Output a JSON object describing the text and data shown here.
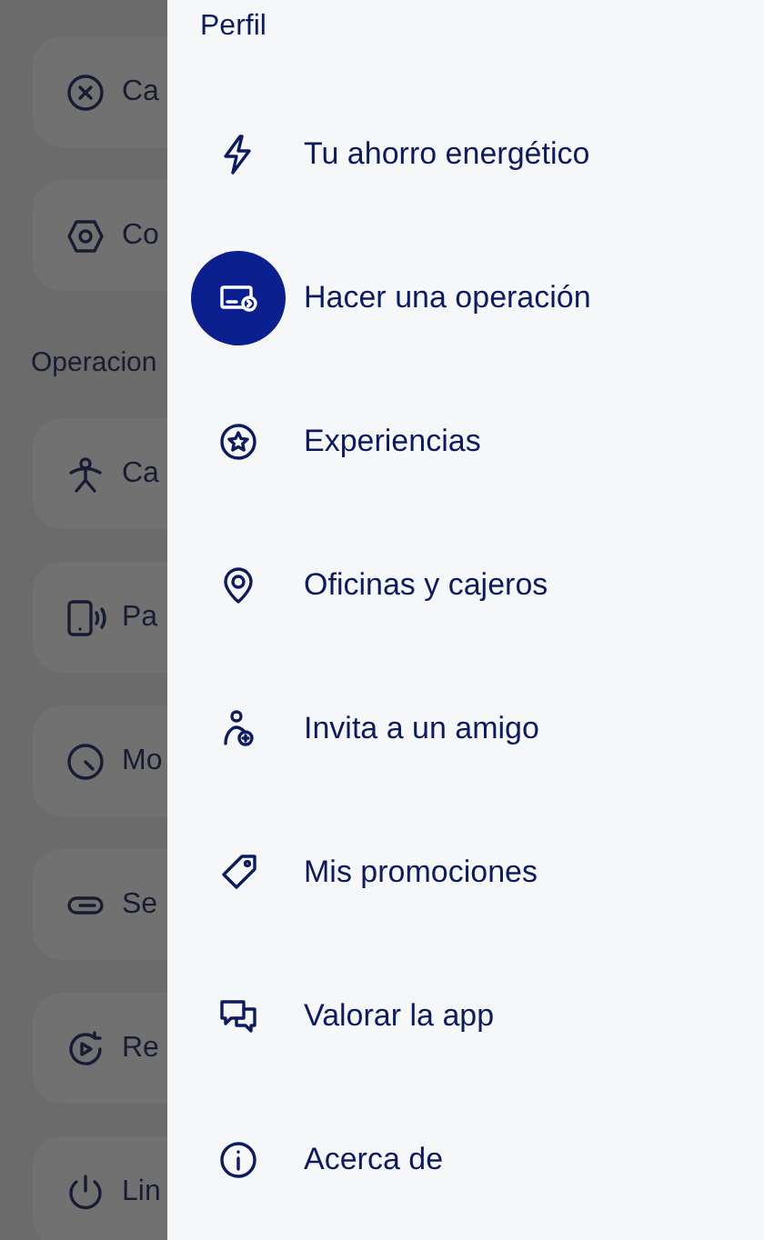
{
  "background_page": {
    "items": [
      {
        "kind": "card",
        "label": "Ca"
      },
      {
        "kind": "card",
        "label": "Co"
      },
      {
        "kind": "heading",
        "label": "Operacion"
      },
      {
        "kind": "card",
        "label": "Ca"
      },
      {
        "kind": "card",
        "label": "Pa"
      },
      {
        "kind": "card",
        "label": "Mo"
      },
      {
        "kind": "card",
        "label": "Se"
      },
      {
        "kind": "card",
        "label": "Re"
      },
      {
        "kind": "card",
        "label": "Lin"
      }
    ]
  },
  "drawer": {
    "title": "Perfil",
    "items": [
      {
        "label": "Tu ahorro energético",
        "selected": false
      },
      {
        "label": "Hacer una operación",
        "selected": true
      },
      {
        "label": "Experiencias",
        "selected": false
      },
      {
        "label": "Oficinas y cajeros",
        "selected": false
      },
      {
        "label": "Invita a un amigo",
        "selected": false
      },
      {
        "label": "Mis promociones",
        "selected": false
      },
      {
        "label": "Valorar la app",
        "selected": false
      },
      {
        "label": "Acerca de",
        "selected": false
      }
    ]
  }
}
